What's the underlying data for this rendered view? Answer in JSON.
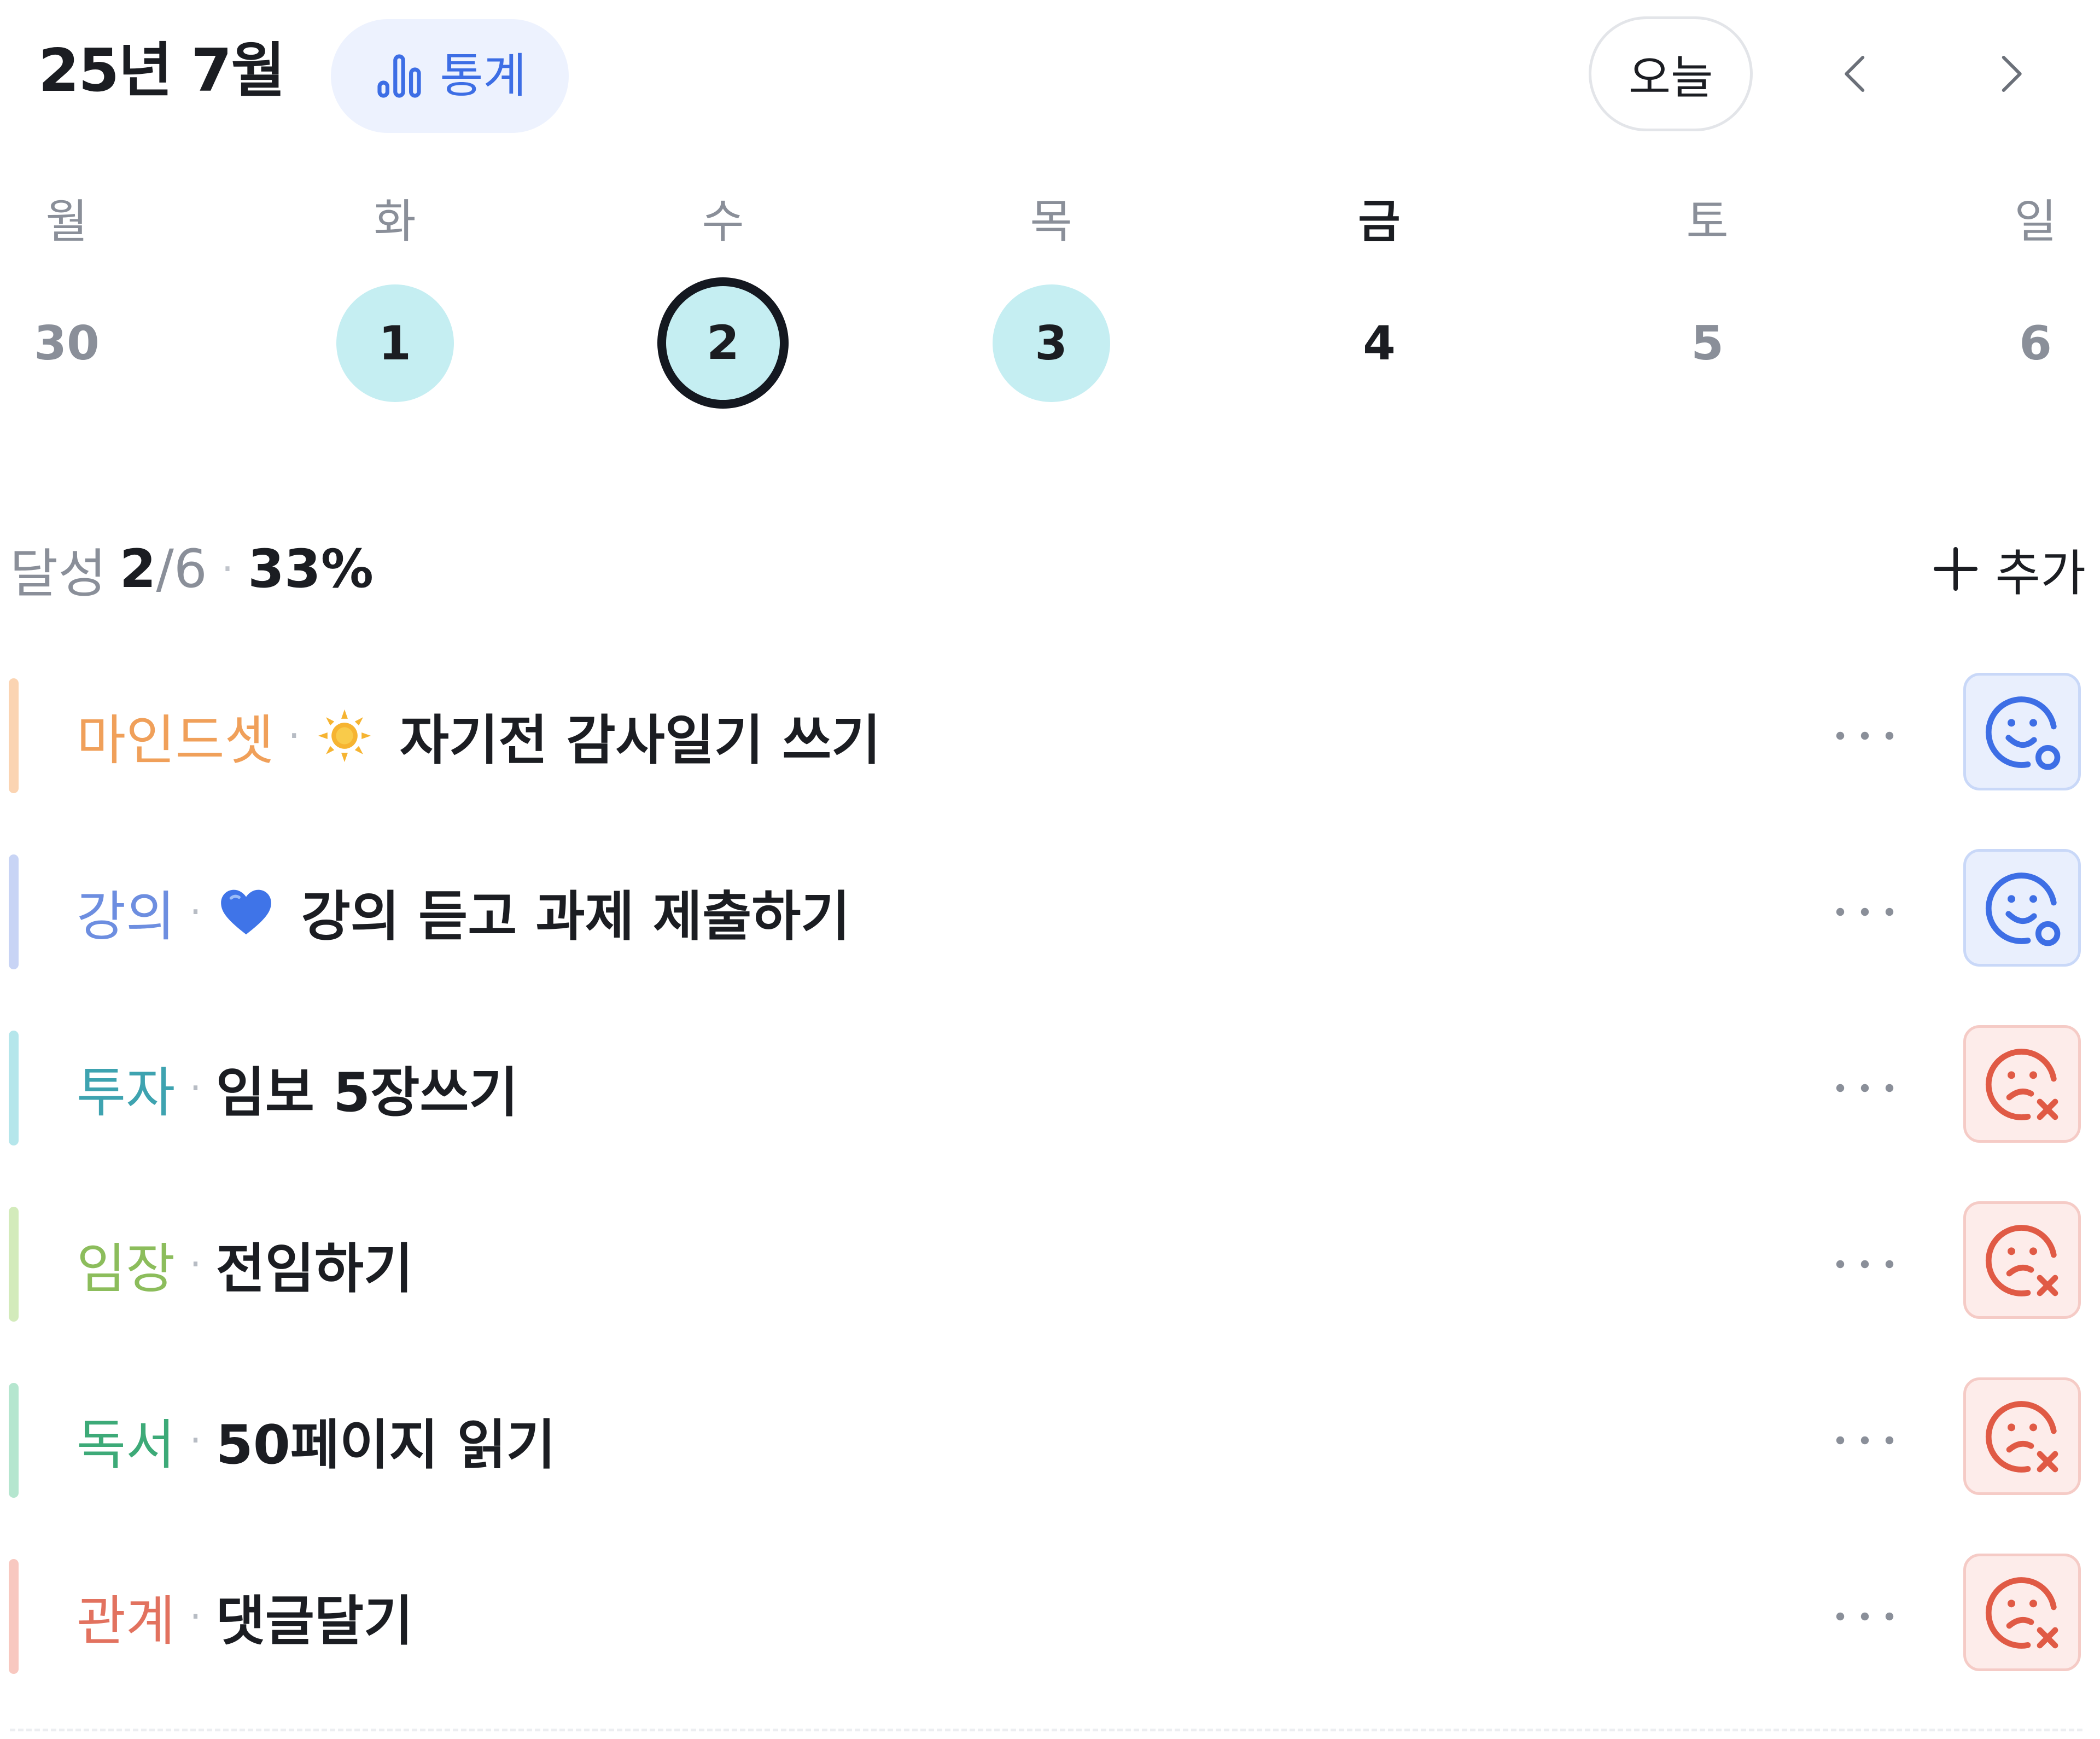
{
  "header": {
    "month_title": "25년 7월",
    "stats_label": "통계",
    "today_label": "오늘",
    "prev_icon": "chevron-left-icon",
    "next_icon": "chevron-right-icon"
  },
  "week": {
    "days": [
      {
        "name": "월",
        "date": "30",
        "state": "other-month"
      },
      {
        "name": "화",
        "date": "1",
        "state": "done"
      },
      {
        "name": "수",
        "date": "2",
        "state": "selected"
      },
      {
        "name": "목",
        "date": "3",
        "state": "done"
      },
      {
        "name": "금",
        "date": "4",
        "state": "today"
      },
      {
        "name": "토",
        "date": "5",
        "state": "none"
      },
      {
        "name": "일",
        "date": "6",
        "state": "none"
      }
    ]
  },
  "summary": {
    "label": "달성",
    "done": "2",
    "total": "/6",
    "separator": "·",
    "percent": "33%",
    "add_label": "추가"
  },
  "habits": [
    {
      "category": "마인드셋",
      "category_color": "#f0a05a",
      "bar_color": "#fbd4b2",
      "separator": "·",
      "emoji": "sun-icon",
      "title": "자기전 감사일기 쓰기",
      "status": "success",
      "status_icon": "smile-check-icon"
    },
    {
      "category": "강의",
      "category_color": "#6d8ee0",
      "bar_color": "#c8d4f5",
      "separator": "·",
      "emoji": "blue-heart-icon",
      "title": "강의 듣고 과제 제출하기",
      "status": "success",
      "status_icon": "smile-check-icon"
    },
    {
      "category": "투자",
      "category_color": "#3ea3b0",
      "bar_color": "#b5e6eb",
      "separator": "·",
      "emoji": "",
      "title": "임보 5장쓰기",
      "status": "fail",
      "status_icon": "sad-x-icon"
    },
    {
      "category": "임장",
      "category_color": "#8cbd5c",
      "bar_color": "#d3ebbb",
      "separator": "·",
      "emoji": "",
      "title": "전임하기",
      "status": "fail",
      "status_icon": "sad-x-icon"
    },
    {
      "category": "독서",
      "category_color": "#3daa78",
      "bar_color": "#b5e6cf",
      "separator": "·",
      "emoji": "",
      "title": "50페이지 읽기",
      "status": "fail",
      "status_icon": "sad-x-icon"
    },
    {
      "category": "관계",
      "category_color": "#e2725f",
      "bar_color": "#f8c8c0",
      "separator": "·",
      "emoji": "",
      "title": "댓글달기",
      "status": "fail",
      "status_icon": "sad-x-icon"
    }
  ],
  "colors": {
    "accent": "#3d6ee5",
    "done_day": "#c5eef2",
    "fail": "#e05a45"
  }
}
